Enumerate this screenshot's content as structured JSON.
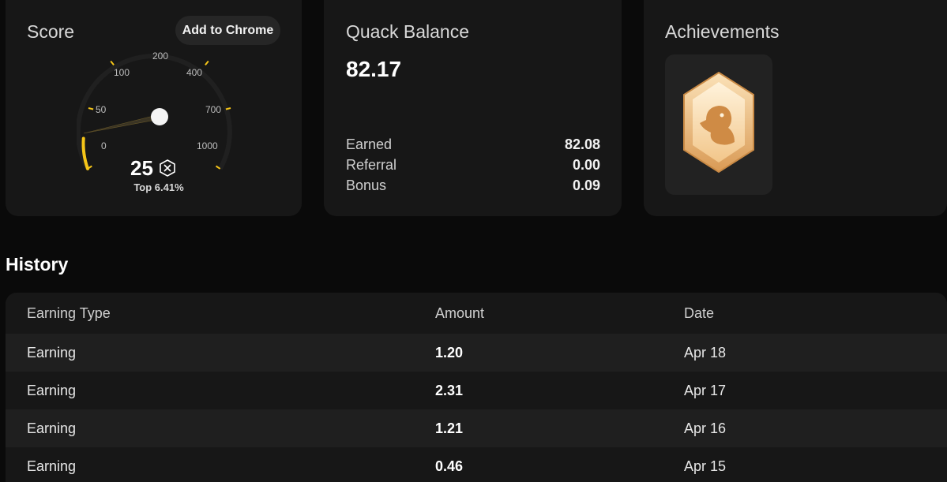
{
  "score_card": {
    "title": "Score",
    "add_to_chrome_label": "Add to Chrome",
    "score": "25",
    "rank": "Top 6.41%",
    "gauge_labels": [
      "0",
      "50",
      "100",
      "200",
      "400",
      "700",
      "1000"
    ],
    "gauge_accent": "#f5c518"
  },
  "balance_card": {
    "title": "Quack Balance",
    "total": "82.17",
    "rows": [
      {
        "label": "Earned",
        "value": "82.08"
      },
      {
        "label": "Referral",
        "value": "0.00"
      },
      {
        "label": "Bonus",
        "value": "0.09"
      }
    ]
  },
  "achievements_card": {
    "title": "Achievements",
    "badges": [
      {
        "icon": "duck-hexagon-badge-icon",
        "color": "#e8a866"
      }
    ]
  },
  "history": {
    "title": "History",
    "columns": [
      "Earning Type",
      "Amount",
      "Date"
    ],
    "rows": [
      {
        "type": "Earning",
        "amount": "1.20",
        "date": "Apr 18"
      },
      {
        "type": "Earning",
        "amount": "2.31",
        "date": "Apr 17"
      },
      {
        "type": "Earning",
        "amount": "1.21",
        "date": "Apr 16"
      },
      {
        "type": "Earning",
        "amount": "0.46",
        "date": "Apr 15"
      }
    ]
  }
}
